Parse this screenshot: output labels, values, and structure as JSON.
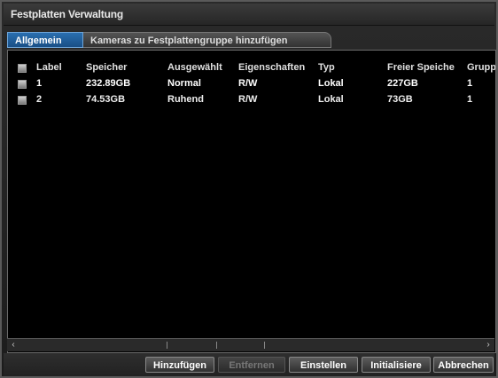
{
  "window": {
    "title": "Festplatten Verwaltung"
  },
  "tabs": [
    {
      "label": "Allgemein",
      "active": true
    },
    {
      "label": "Kameras zu Festplattengruppe hinzufügen",
      "active": false
    }
  ],
  "table": {
    "columns": [
      "Label",
      "Speicher",
      "Ausgewählt",
      "Eigenschaften",
      "Typ",
      "Freier Speiche",
      "Grupp"
    ],
    "rows": [
      {
        "label": "1",
        "speicher": "232.89GB",
        "ausgewaehlt": "Normal",
        "eigenschaften": "R/W",
        "typ": "Lokal",
        "frei": "227GB",
        "gruppe": "1"
      },
      {
        "label": "2",
        "speicher": "74.53GB",
        "ausgewaehlt": "Ruhend",
        "eigenschaften": "R/W",
        "typ": "Lokal",
        "frei": "73GB",
        "gruppe": "1"
      }
    ]
  },
  "scroll": {
    "left_arrow": "‹",
    "right_arrow": "›"
  },
  "buttons": {
    "add": "Hinzufügen",
    "remove": "Entfernen",
    "settings": "Einstellen",
    "init": "Initialisiere",
    "cancel": "Abbrechen"
  },
  "colors": {
    "accent": "#1f5f9e",
    "background": "#000000",
    "text": "#ffffff"
  }
}
